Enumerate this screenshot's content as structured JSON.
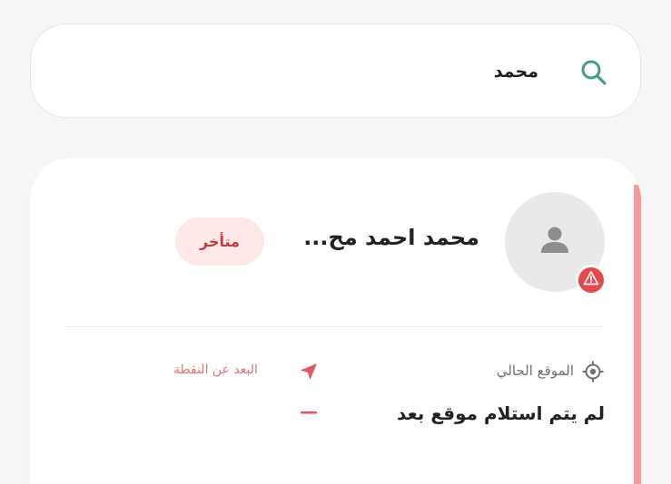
{
  "search": {
    "value": "محمد",
    "icon": "search-icon",
    "icon_color": "#3f9e8c"
  },
  "card": {
    "name": "محمد احمد مح...",
    "status": "متأخر",
    "status_color": "#c23a3a",
    "accent_color": "#f29a9d",
    "avatar_icon": "person-icon",
    "alert_icon": "warning-icon",
    "alert_color": "#e7474d",
    "current_location": {
      "label": "الموقع الحالي",
      "icon": "target-icon",
      "value": "لم يتم استلام موقع بعد"
    },
    "distance": {
      "label": "البعد عن النقطة",
      "icon": "navigation-arrow-icon",
      "value": "—"
    }
  }
}
